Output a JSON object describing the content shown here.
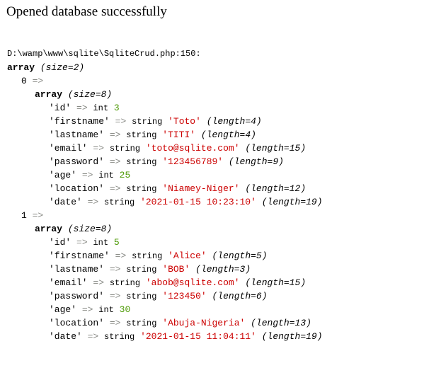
{
  "message": "Opened database successfully",
  "dump": {
    "location": "D:\\wamp\\www\\sqlite\\SqliteCrud.php:150:",
    "keyword_array": "array",
    "outer_size": "(size=2)",
    "arrow": "=>",
    "records": [
      {
        "index": "0",
        "size": "(size=8)",
        "fields": [
          {
            "key": "'id'",
            "type": "int",
            "value": "3",
            "length": "",
            "kind": "int"
          },
          {
            "key": "'firstname'",
            "type": "string",
            "value": "'Toto'",
            "length": "(length=4)",
            "kind": "string"
          },
          {
            "key": "'lastname'",
            "type": "string",
            "value": "'TITI'",
            "length": "(length=4)",
            "kind": "string"
          },
          {
            "key": "'email'",
            "type": "string",
            "value": "'toto@sqlite.com'",
            "length": "(length=15)",
            "kind": "string"
          },
          {
            "key": "'password'",
            "type": "string",
            "value": "'123456789'",
            "length": "(length=9)",
            "kind": "string"
          },
          {
            "key": "'age'",
            "type": "int",
            "value": "25",
            "length": "",
            "kind": "int"
          },
          {
            "key": "'location'",
            "type": "string",
            "value": "'Niamey-Niger'",
            "length": "(length=12)",
            "kind": "string"
          },
          {
            "key": "'date'",
            "type": "string",
            "value": "'2021-01-15 10:23:10'",
            "length": "(length=19)",
            "kind": "string"
          }
        ]
      },
      {
        "index": "1",
        "size": "(size=8)",
        "fields": [
          {
            "key": "'id'",
            "type": "int",
            "value": "5",
            "length": "",
            "kind": "int"
          },
          {
            "key": "'firstname'",
            "type": "string",
            "value": "'Alice'",
            "length": "(length=5)",
            "kind": "string"
          },
          {
            "key": "'lastname'",
            "type": "string",
            "value": "'BOB'",
            "length": "(length=3)",
            "kind": "string"
          },
          {
            "key": "'email'",
            "type": "string",
            "value": "'abob@sqlite.com'",
            "length": "(length=15)",
            "kind": "string"
          },
          {
            "key": "'password'",
            "type": "string",
            "value": "'123450'",
            "length": "(length=6)",
            "kind": "string"
          },
          {
            "key": "'age'",
            "type": "int",
            "value": "30",
            "length": "",
            "kind": "int"
          },
          {
            "key": "'location'",
            "type": "string",
            "value": "'Abuja-Nigeria'",
            "length": "(length=13)",
            "kind": "string"
          },
          {
            "key": "'date'",
            "type": "string",
            "value": "'2021-01-15 11:04:11'",
            "length": "(length=19)",
            "kind": "string"
          }
        ]
      }
    ]
  }
}
